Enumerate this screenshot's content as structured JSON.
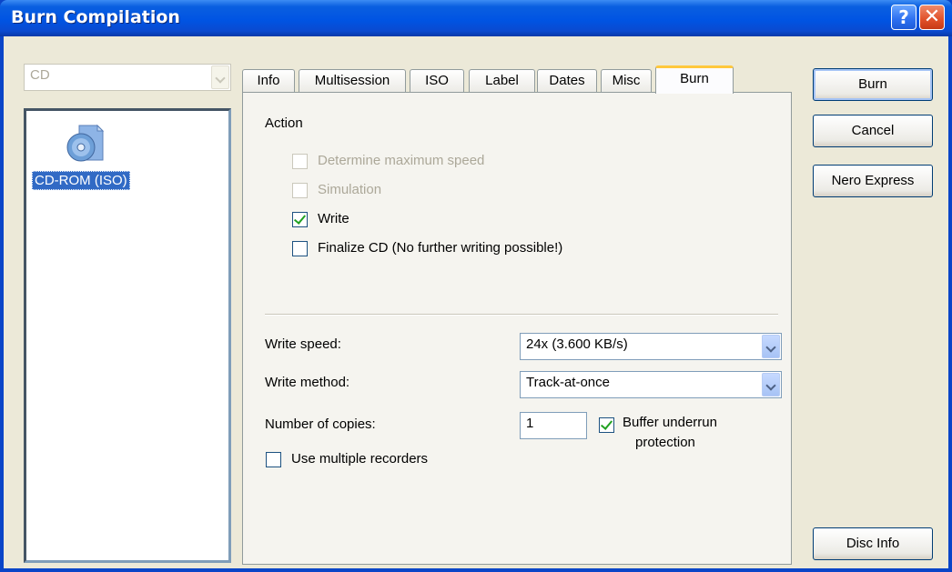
{
  "window": {
    "title": "Burn Compilation",
    "help_label": "?",
    "close_label": "✕"
  },
  "left": {
    "media_combo": "CD",
    "items": [
      {
        "label": "CD-ROM (ISO)",
        "icon": "cd-rom-iso-icon",
        "selected": true
      }
    ]
  },
  "tabs": [
    {
      "label": "Info"
    },
    {
      "label": "Multisession"
    },
    {
      "label": "ISO"
    },
    {
      "label": "Label"
    },
    {
      "label": "Dates"
    },
    {
      "label": "Misc"
    },
    {
      "label": "Burn",
      "active": true
    }
  ],
  "burn": {
    "action_header": "Action",
    "options": [
      {
        "label": "Determine maximum speed",
        "checked": false,
        "enabled": false
      },
      {
        "label": "Simulation",
        "checked": false,
        "enabled": false
      },
      {
        "label": "Write",
        "checked": true,
        "enabled": true
      },
      {
        "label": "Finalize CD (No further writing possible!)",
        "checked": false,
        "enabled": true
      }
    ],
    "write_speed_label": "Write speed:",
    "write_speed_value": "24x (3.600 KB/s)",
    "write_method_label": "Write method:",
    "write_method_value": "Track-at-once",
    "copies_label": "Number of copies:",
    "copies_value": "1",
    "buffer_label_1": "Buffer underrun",
    "buffer_label_2": "protection",
    "buffer_checked": true,
    "multiple_recorders_label": "Use multiple recorders",
    "multiple_recorders_checked": false
  },
  "buttons": {
    "burn": "Burn",
    "cancel": "Cancel",
    "nero_express": "Nero Express",
    "disc_info": "Disc Info"
  }
}
